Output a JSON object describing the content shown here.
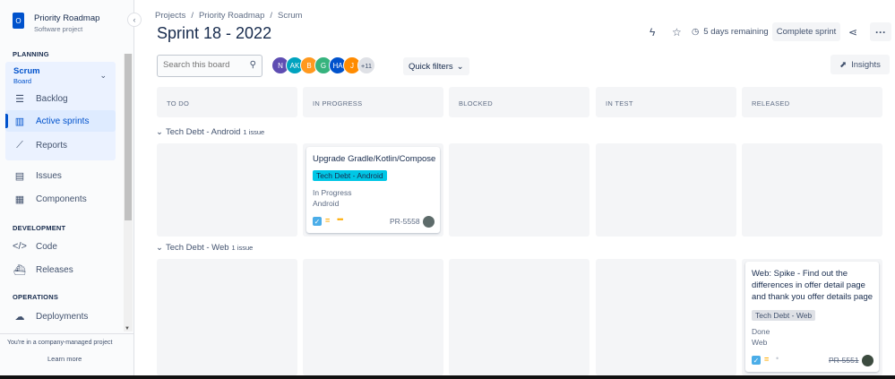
{
  "sidebar": {
    "project_avatar": "O",
    "project_name": "Priority Roadmap",
    "project_type": "Software project",
    "planning_title": "PLANNING",
    "board": {
      "name": "Scrum",
      "sub": "Board"
    },
    "planning_items": [
      {
        "label": "Backlog",
        "icon": "backlog-icon"
      },
      {
        "label": "Active sprints",
        "icon": "board-columns-icon"
      },
      {
        "label": "Reports",
        "icon": "chart-line-icon"
      }
    ],
    "issues_label": "Issues",
    "components_label": "Components",
    "development_title": "DEVELOPMENT",
    "code_label": "Code",
    "releases_label": "Releases",
    "operations_title": "OPERATIONS",
    "deployments_label": "Deployments",
    "footer_note": "You're in a company-managed project",
    "learn_more": "Learn more"
  },
  "header": {
    "breadcrumbs": [
      "Projects",
      "Priority Roadmap",
      "Scrum"
    ],
    "title": "Sprint 18 - 2022",
    "days_remaining": "5 days remaining",
    "complete_sprint": "Complete sprint"
  },
  "toolbar": {
    "search_placeholder": "Search this board",
    "avatars": [
      {
        "initials": "N",
        "color": "#5e4db2"
      },
      {
        "initials": "AK",
        "color": "#00a3bf"
      },
      {
        "initials": "B",
        "color": "#ff991f"
      },
      {
        "initials": "G",
        "color": "#36b37e"
      },
      {
        "initials": "HA",
        "color": "#0052cc"
      },
      {
        "initials": "J",
        "color": "#ff8b00"
      }
    ],
    "more_avatars": "+11",
    "quick_filters": "Quick filters",
    "insights": "Insights"
  },
  "columns": [
    "TO DO",
    "IN PROGRESS",
    "BLOCKED",
    "IN TEST",
    "RELEASED"
  ],
  "swimlanes": [
    {
      "name": "Tech Debt - Android",
      "count": "1 issue",
      "card": {
        "title": "Upgrade Gradle/Kotlin/Compose",
        "epic": "Tech Debt - Android",
        "status": "In Progress",
        "component": "Android",
        "key": "PR-5558"
      }
    },
    {
      "name": "Tech Debt - Web",
      "count": "1 issue",
      "card": {
        "title": "Web: Spike - Find out the differences in offer detail page and thank you offer details page",
        "epic": "Tech Debt - Web",
        "status": "Done",
        "component": "Web",
        "key": "PR-5551"
      }
    }
  ],
  "colors": {
    "accent": "#0052cc",
    "epic_android": "#00c7e6",
    "epic_web": "#dfe1e6",
    "column_bg": "#f4f5f7"
  }
}
